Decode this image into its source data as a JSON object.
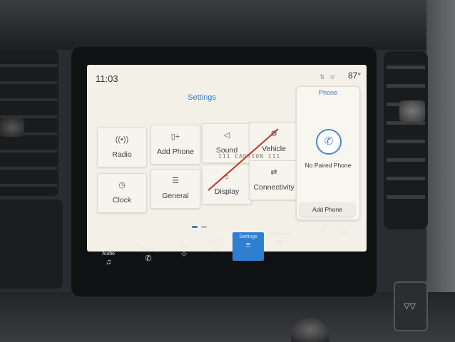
{
  "status": {
    "time": "11:03",
    "icons": "⇅ ᯤ",
    "temperature": "87°"
  },
  "settings": {
    "title": "Settings",
    "tiles": [
      {
        "icon": "signal-icon",
        "glyph": "((•))",
        "label": "Radio"
      },
      {
        "icon": "add-phone-icon",
        "glyph": "▯+",
        "label": "Add Phone"
      },
      {
        "icon": "speaker-icon",
        "glyph": "◁",
        "label": "Sound"
      },
      {
        "icon": "vehicle-icon",
        "glyph": "⚙",
        "label": "Vehicle"
      },
      {
        "icon": "clock-icon",
        "glyph": "◷",
        "label": "Clock"
      },
      {
        "icon": "sliders-icon",
        "glyph": "☰",
        "label": "General"
      },
      {
        "icon": "display-icon",
        "glyph": "☼",
        "label": "Display"
      },
      {
        "icon": "connectivity-icon",
        "glyph": "⇄",
        "label": "Connectivity"
      }
    ]
  },
  "phone_panel": {
    "title": "Phone",
    "status": "No Paired Phone",
    "add_button": "Add Phone"
  },
  "handwriting": "111 CAUTION 111",
  "bottom_nav": [
    {
      "label": "Audio",
      "icon": "♫"
    },
    {
      "label": "Phone",
      "icon": "✆"
    },
    {
      "label": "Fav",
      "icon": "☆"
    },
    {
      "label": "Apps",
      "icon": "⠿"
    },
    {
      "label": "Settings",
      "icon": "≡"
    },
    {
      "label": "Features",
      "icon": "⇆"
    }
  ],
  "scroll_buttons": [
    "⌄",
    "⌃",
    "▢"
  ],
  "hw_button_label": "▽▽"
}
